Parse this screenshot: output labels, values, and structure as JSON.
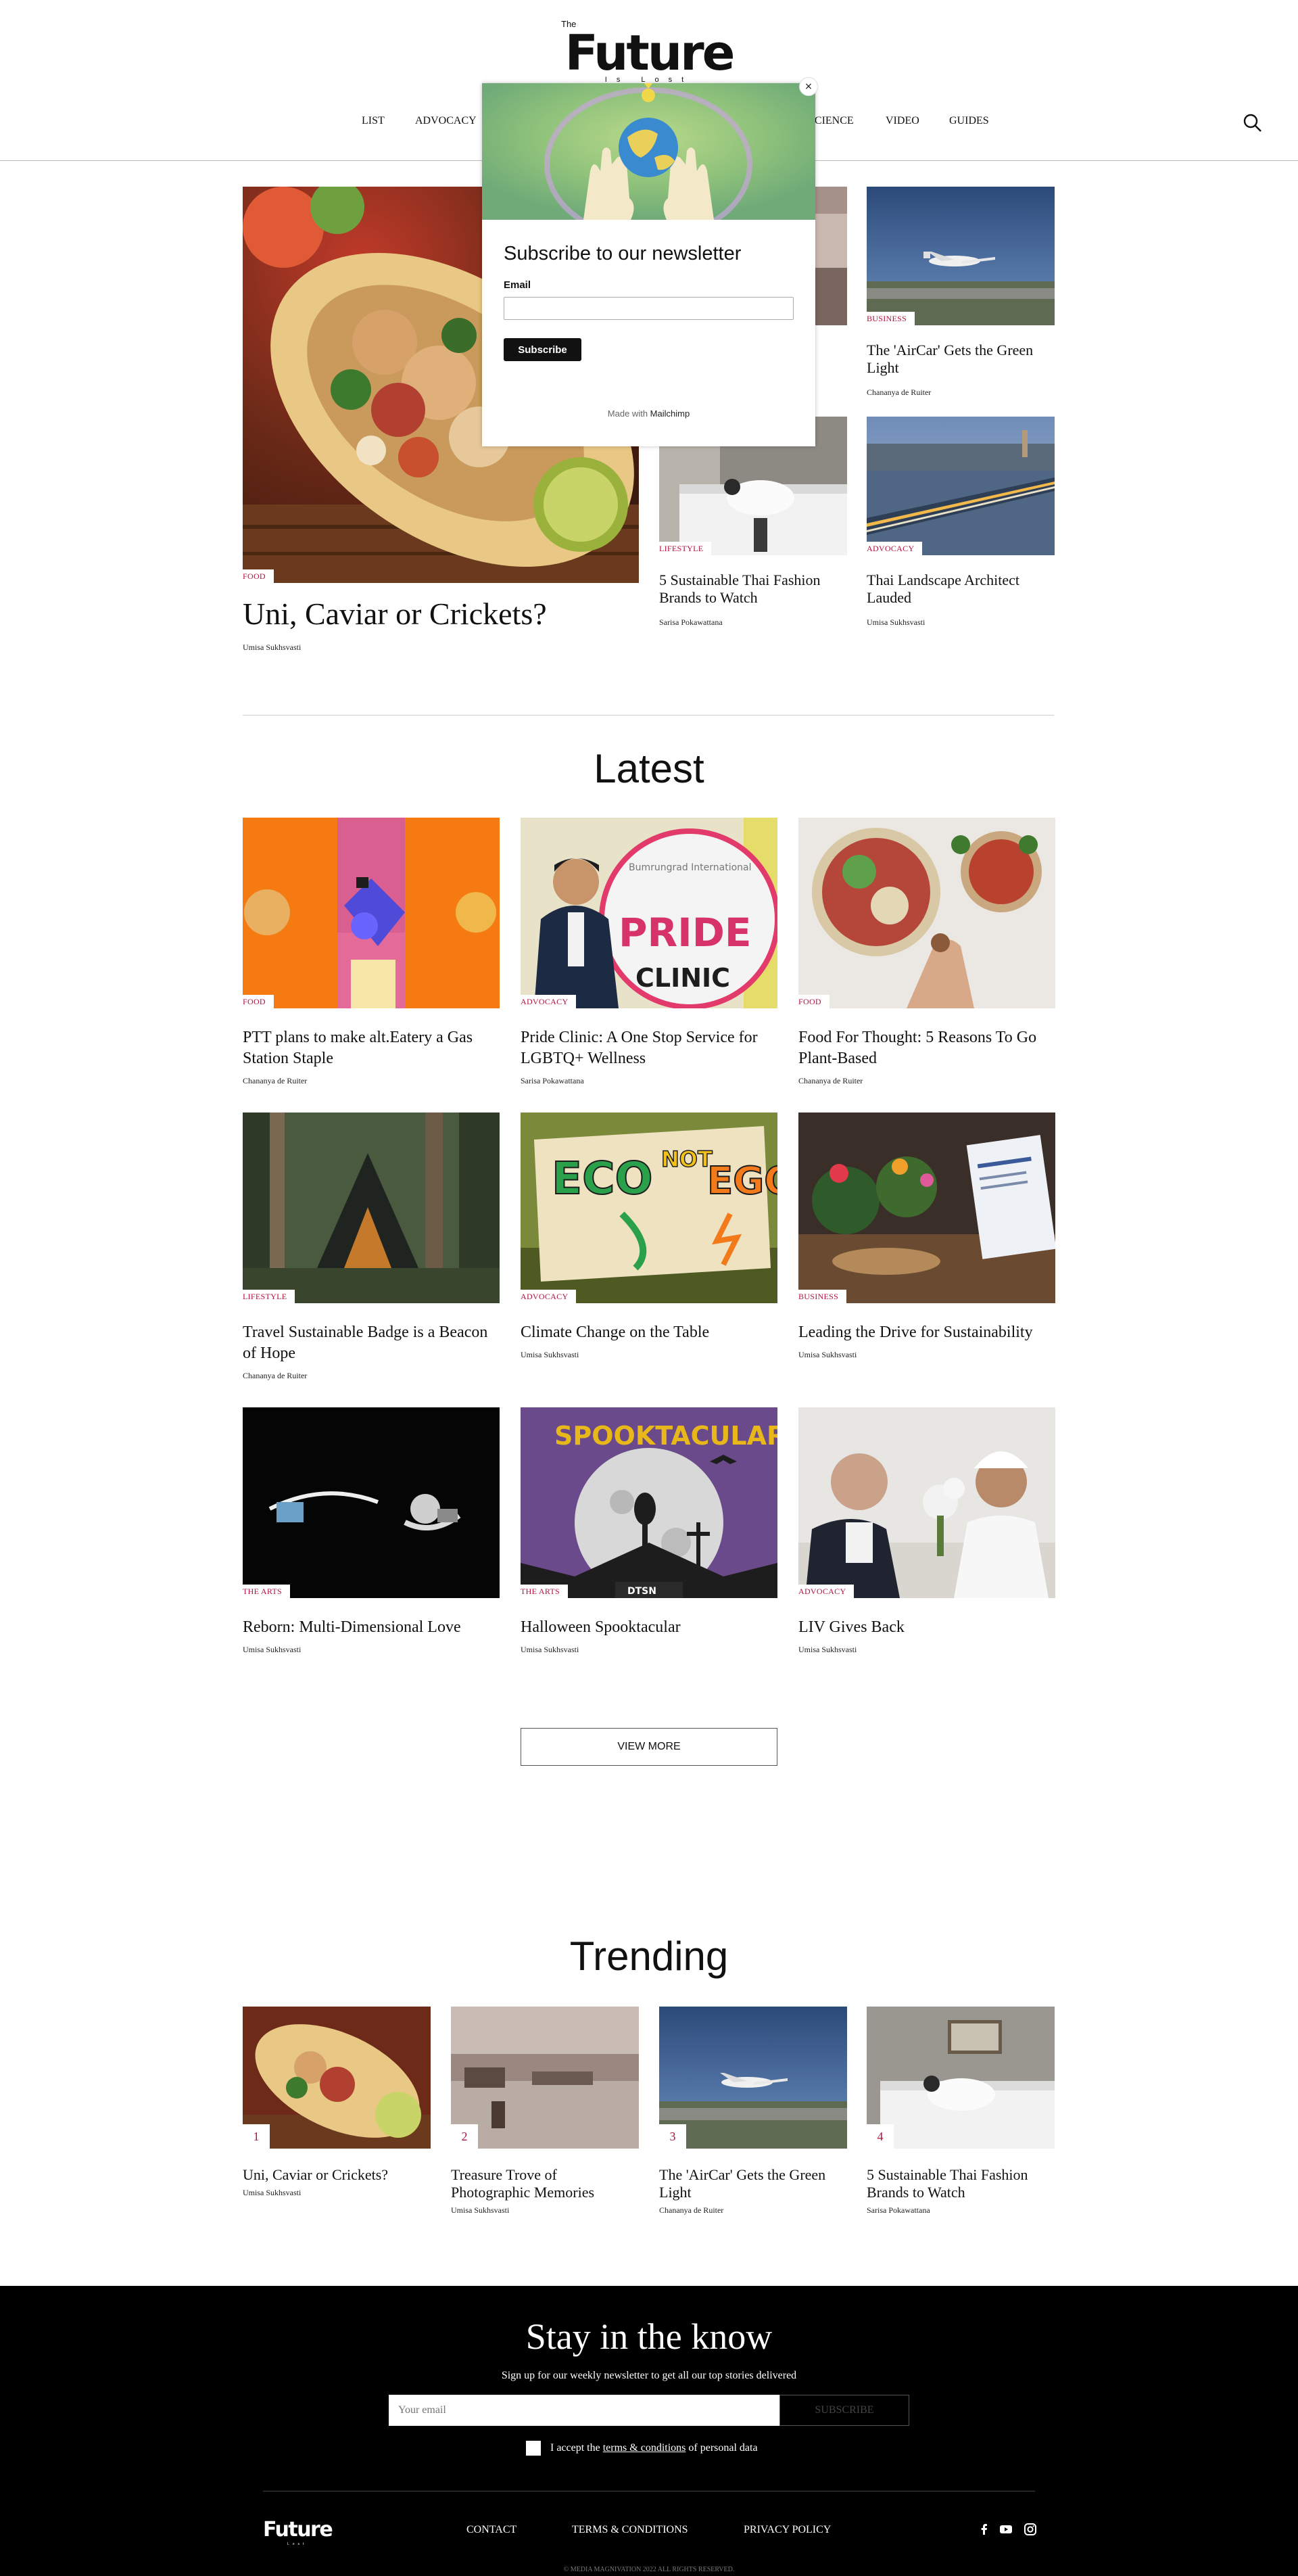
{
  "header": {
    "logo_the": "The",
    "logo_main": "Future",
    "logo_sub": "Is Lost",
    "nav": [
      "LIST",
      "ADVOCACY",
      "SCIENCE",
      "VIDEO",
      "GUIDES"
    ],
    "search_icon": "search-icon"
  },
  "hero": {
    "main": {
      "tag": "FOOD",
      "title": "Uni, Caviar or Crickets?",
      "author": "Umisa Sukhsvasti"
    },
    "side": [
      {
        "tag": "",
        "title": "",
        "author": ""
      },
      {
        "tag": "BUSINESS",
        "title": "The 'AirCar' Gets the Green Light",
        "author": "Chananya de Ruiter"
      },
      {
        "tag": "LIFESTYLE",
        "title": "5 Sustainable Thai Fashion Brands to Watch",
        "author": "Sarisa Pokawattana"
      },
      {
        "tag": "ADVOCACY",
        "title": "Thai Landscape Architect Lauded",
        "author": "Umisa Sukhsvasti"
      }
    ]
  },
  "latest": {
    "heading": "Latest",
    "items": [
      {
        "tag": "FOOD",
        "title": "PTT plans to make alt.Eatery a Gas Station Staple",
        "author": "Chananya de Ruiter"
      },
      {
        "tag": "ADVOCACY",
        "title": "Pride Clinic: A One Stop Service for LGBTQ+ Wellness",
        "author": "Sarisa Pokawattana"
      },
      {
        "tag": "FOOD",
        "title": "Food For Thought: 5 Reasons To Go Plant-Based",
        "author": "Chananya de Ruiter"
      },
      {
        "tag": "LIFESTYLE",
        "title": "Travel Sustainable Badge is a Beacon of Hope",
        "author": "Chananya de Ruiter"
      },
      {
        "tag": "ADVOCACY",
        "title": "Climate Change on the Table",
        "author": "Umisa Sukhsvasti"
      },
      {
        "tag": "BUSINESS",
        "title": "Leading the Drive for Sustainability",
        "author": "Umisa Sukhsvasti"
      },
      {
        "tag": "THE ARTS",
        "title": "Reborn: Multi-Dimensional Love",
        "author": "Umisa Sukhsvasti"
      },
      {
        "tag": "THE ARTS",
        "title": "Halloween Spooktacular",
        "author": "Umisa Sukhsvasti"
      },
      {
        "tag": "ADVOCACY",
        "title": "LIV Gives Back",
        "author": "Umisa Sukhsvasti"
      }
    ],
    "view_more": "VIEW MORE",
    "img_text": {
      "pride_top": "Bumrungrad International",
      "pride_word": "PRIDE",
      "pride_clinic": "CLINIC",
      "eco_a": "ECO",
      "eco_not": "NOT",
      "eco_b": "EGO",
      "spook": "SPOOKTACULAR",
      "dtsn": "DTSN"
    }
  },
  "trending": {
    "heading": "Trending",
    "items": [
      {
        "num": "1",
        "title": "Uni, Caviar or Crickets?",
        "author": "Umisa Sukhsvasti"
      },
      {
        "num": "2",
        "title": "Treasure Trove of Photographic Memories",
        "author": "Umisa Sukhsvasti"
      },
      {
        "num": "3",
        "title": "The 'AirCar' Gets the Green Light",
        "author": "Chananya de Ruiter"
      },
      {
        "num": "4",
        "title": "5 Sustainable Thai Fashion Brands to Watch",
        "author": "Sarisa Pokawattana"
      }
    ]
  },
  "footer": {
    "title": "Stay in the know",
    "subtitle": "Sign up for our weekly newsletter to get all our top stories delivered",
    "email_placeholder": "Your email",
    "subscribe": "SUBSCRIBE",
    "consent_prefix": "I accept the ",
    "consent_link": "terms & conditions",
    "consent_suffix": " of personal data",
    "logo_main": "Future",
    "logo_sub": "Lost",
    "links": [
      "CONTACT",
      "TERMS & CONDITIONS",
      "PRIVACY POLICY"
    ],
    "social": [
      "facebook-icon",
      "youtube-icon",
      "instagram-icon"
    ],
    "copyright": "© MEDIA MAGNIVATION 2022 ALL RIGHTS RESERVED."
  },
  "modal": {
    "title": "Subscribe to our newsletter",
    "email_label": "Email",
    "button": "Subscribe",
    "made_with": "Made with ",
    "made_brand": "Mailchimp",
    "close": "×"
  },
  "colors": {
    "accent": "#b3123b",
    "footer_bg": "#000000"
  }
}
